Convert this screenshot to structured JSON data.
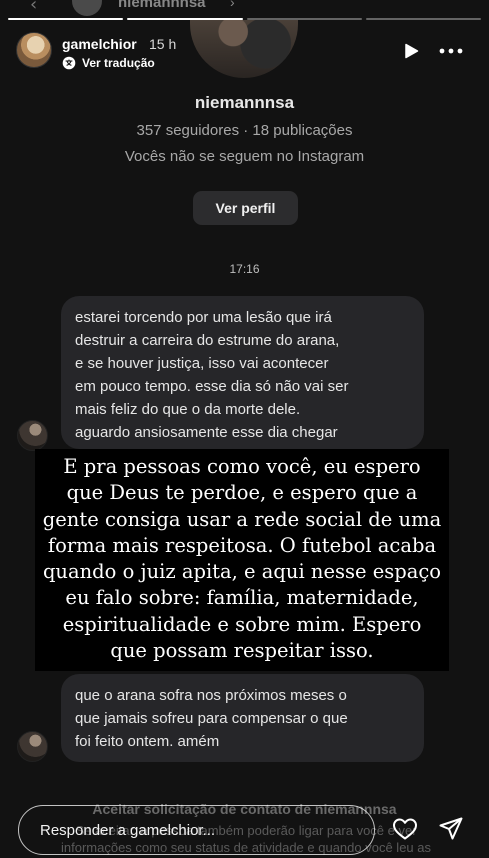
{
  "ghost_header": {
    "name": "niemannnsa"
  },
  "progress": {
    "segments": 4,
    "current": 2
  },
  "story": {
    "username": "gamelchior",
    "time_ago": "15 h",
    "translate_label": "Ver tradução",
    "play_icon": "play-icon",
    "more_icon": "more-icon"
  },
  "dm_profile": {
    "username": "niemannnsa",
    "stats": "357 seguidores · 18 publicações",
    "follow_status": "Vocês não se seguem no Instagram",
    "view_profile_label": "Ver perfil"
  },
  "conversation": {
    "timestamp": "17:16",
    "messages": [
      {
        "lines": [
          "estarei torcendo por uma lesão que irá",
          "destruir a carreira do estrume do arana,",
          "e se houver justiça, isso vai acontecer",
          "em pouco tempo. esse dia só não vai ser",
          "mais feliz do que o da morte dele.",
          "aguardo ansiosamente esse dia chegar"
        ]
      },
      {
        "lines": [
          "que o arana sofra nos próximos meses o",
          "que jamais sofreu para compensar o que",
          "foi feito ontem. amém"
        ]
      }
    ]
  },
  "caption": {
    "lines": [
      "E pra pessoas como você, eu espero",
      "que Deus te perdoe, e espero que a",
      "gente consiga usar a rede social de uma",
      "forma mais respeitosa. O futebol acaba",
      "quando o juiz apita, e aqui nesse espaço",
      "eu falo sobre: família, maternidade,",
      "espiritualidade e sobre mim. Espero",
      "que possam respeitar isso."
    ]
  },
  "request": {
    "title": "Aceitar solicitação de contato de niemannnsa",
    "lines": [
      "Se aceitar, a pessoa também poderão ligar para você e ver",
      "informações como seu status de atividade e quando você leu as"
    ]
  },
  "reply": {
    "placeholder": "Responder a gamelchior..."
  },
  "colors": {
    "background": "#121212",
    "bubble": "#262629",
    "caption_bg": "#000000",
    "secondary_text": "#a8a8a8"
  }
}
